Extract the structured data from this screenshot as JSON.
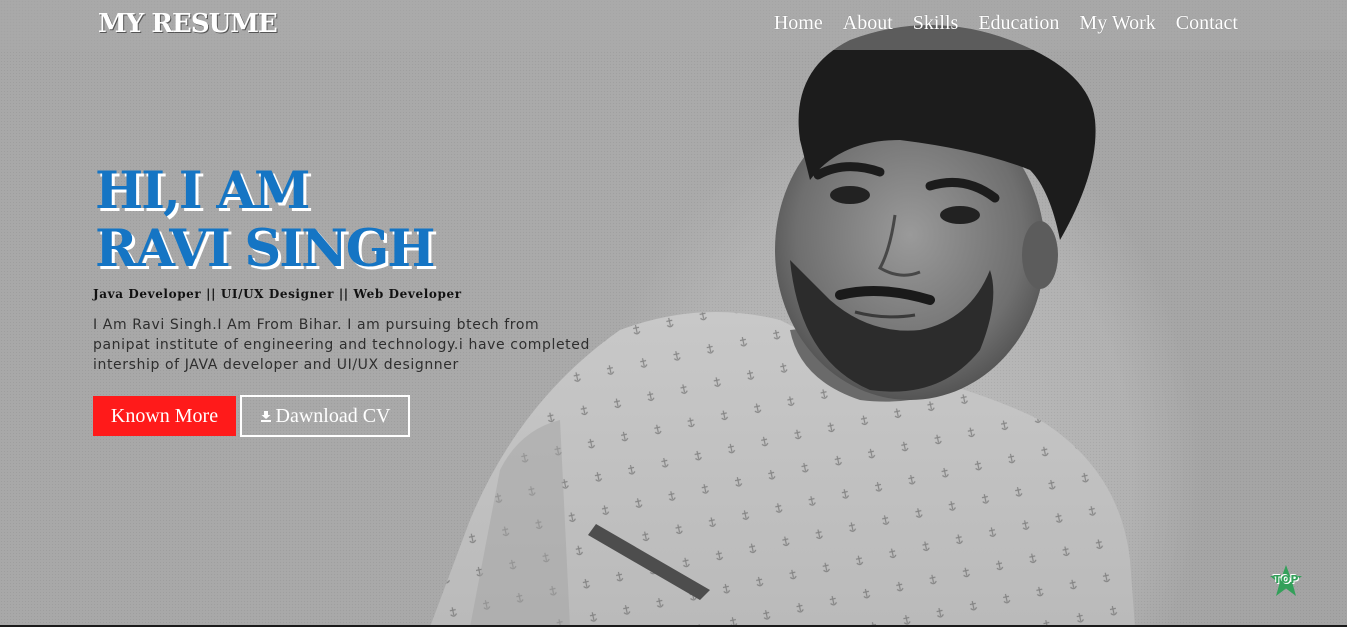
{
  "brand": "MY RESUME",
  "nav": {
    "home": "Home",
    "about": "About",
    "skills": "Skills",
    "education": "Education",
    "my_work": "My Work",
    "contact": "Contact"
  },
  "intro": {
    "greeting": "HI,I AM",
    "name": "RAVI SINGH",
    "roles": "Java Developer || UI/UX Designer || Web Developer",
    "bio": "I Am Ravi Singh.I Am From Bihar. I am pursuing btech from panipat institute of engineering and technology.i have completed intership of JAVA developer and UI/UX designner"
  },
  "buttons": {
    "known_more": "Known More",
    "download_cv": "Dawnload CV"
  },
  "top_button": "TOP",
  "icons": {
    "download": "download-icon",
    "top": "star-top-icon"
  },
  "colors": {
    "headline": "#1575c4",
    "primary_button": "#ff1a1a",
    "top_badge": "#33a05a"
  }
}
